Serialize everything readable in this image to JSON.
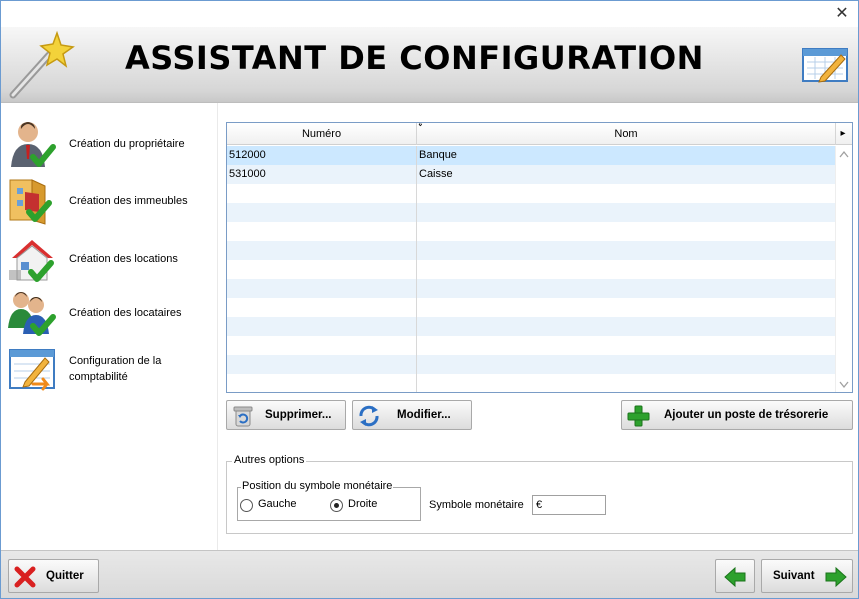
{
  "window": {
    "close_glyph": "✕"
  },
  "banner": {
    "title": "ASSISTANT DE CONFIGURATION",
    "left_icon": "magic-wand-icon",
    "right_icon": "calendar-edit-icon"
  },
  "sidebar": {
    "steps": [
      {
        "label": "Création du propriétaire",
        "icon": "owner-check-icon"
      },
      {
        "label": "Création des immeubles",
        "icon": "building-check-icon"
      },
      {
        "label": "Création des locations",
        "icon": "house-check-icon"
      },
      {
        "label": "Création des locataires",
        "icon": "tenants-check-icon"
      },
      {
        "label": "Configuration de la comptabilité",
        "icon": "accounting-edit-icon"
      }
    ]
  },
  "grid": {
    "columns": [
      "Numéro",
      "Nom"
    ],
    "sort_glyph": "⇕",
    "menu_glyph": "▸",
    "rows": [
      {
        "numero": "512000",
        "nom": "Banque",
        "selected": true
      },
      {
        "numero": "531000",
        "nom": "Caisse",
        "selected": false
      }
    ]
  },
  "actions": {
    "delete_label": "Supprimer...",
    "edit_label": "Modifier...",
    "add_label": "Ajouter un poste de trésorerie"
  },
  "options": {
    "legend": "Autres options",
    "position_legend": "Position du symbole monétaire",
    "left_label": "Gauche",
    "right_label": "Droite",
    "selected_position": "Droite",
    "symbol_label": "Symbole monétaire",
    "symbol_value": "€"
  },
  "footer": {
    "quit_label": "Quitter",
    "next_label": "Suivant"
  },
  "colors": {
    "selection": "#cce8ff",
    "row_alt": "#eaf3fb",
    "accent_green": "#2da12d",
    "accent_red": "#d92020"
  }
}
